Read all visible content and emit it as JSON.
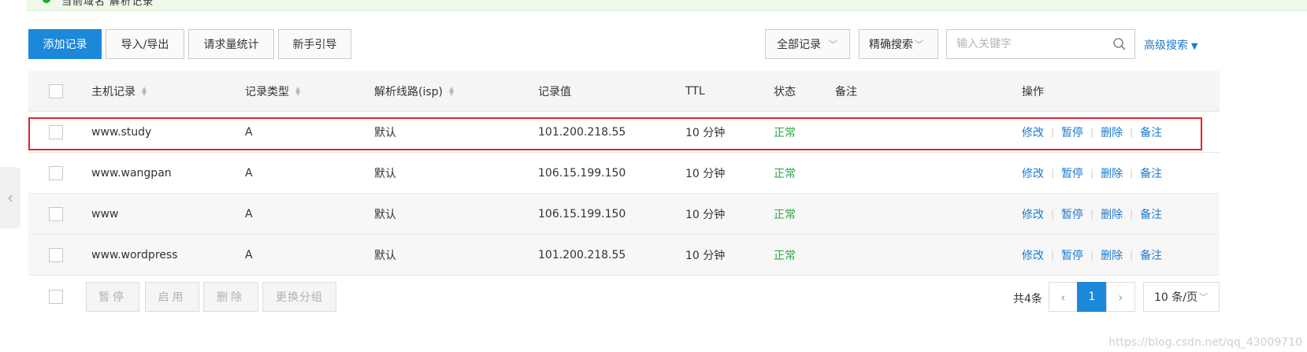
{
  "banner": {
    "text": "当前域名       解析记录"
  },
  "toolbar": {
    "add_label": "添加记录",
    "import_label": "导入/导出",
    "stats_label": "请求量统计",
    "guide_label": "新手引导",
    "filter_value": "全部记录",
    "match_value": "精确搜索",
    "search_placeholder": "输入关键字",
    "advanced_label": "高级搜索"
  },
  "table": {
    "headers": {
      "host": "主机记录",
      "type": "记录类型",
      "line": "解析线路(isp)",
      "value": "记录值",
      "ttl": "TTL",
      "status": "状态",
      "remark": "备注",
      "ops": "操作"
    },
    "rows": [
      {
        "host": "www.study",
        "type": "A",
        "line": "默认",
        "value": "101.200.218.55",
        "ttl": "10 分钟",
        "status": "正常",
        "remark": ""
      },
      {
        "host": "www.wangpan",
        "type": "A",
        "line": "默认",
        "value": "106.15.199.150",
        "ttl": "10 分钟",
        "status": "正常",
        "remark": ""
      },
      {
        "host": "www",
        "type": "A",
        "line": "默认",
        "value": "106.15.199.150",
        "ttl": "10 分钟",
        "status": "正常",
        "remark": ""
      },
      {
        "host": "www.wordpress",
        "type": "A",
        "line": "默认",
        "value": "101.200.218.55",
        "ttl": "10 分钟",
        "status": "正常",
        "remark": ""
      }
    ],
    "ops": {
      "edit": "修改",
      "pause": "暂停",
      "delete": "删除",
      "note": "备注"
    }
  },
  "footer": {
    "pause_label": "暂停",
    "enable_label": "启用",
    "delete_label": "删除",
    "group_label": "更换分组",
    "total_text": "共4条",
    "current_page": "1",
    "page_size": "10 条/页"
  },
  "watermark": "https://blog.csdn.net/qq_43009710",
  "colors": {
    "primary": "#1c88d9",
    "link": "#1c7ad0",
    "status_ok": "#28a745",
    "highlight": "#e0252d"
  }
}
